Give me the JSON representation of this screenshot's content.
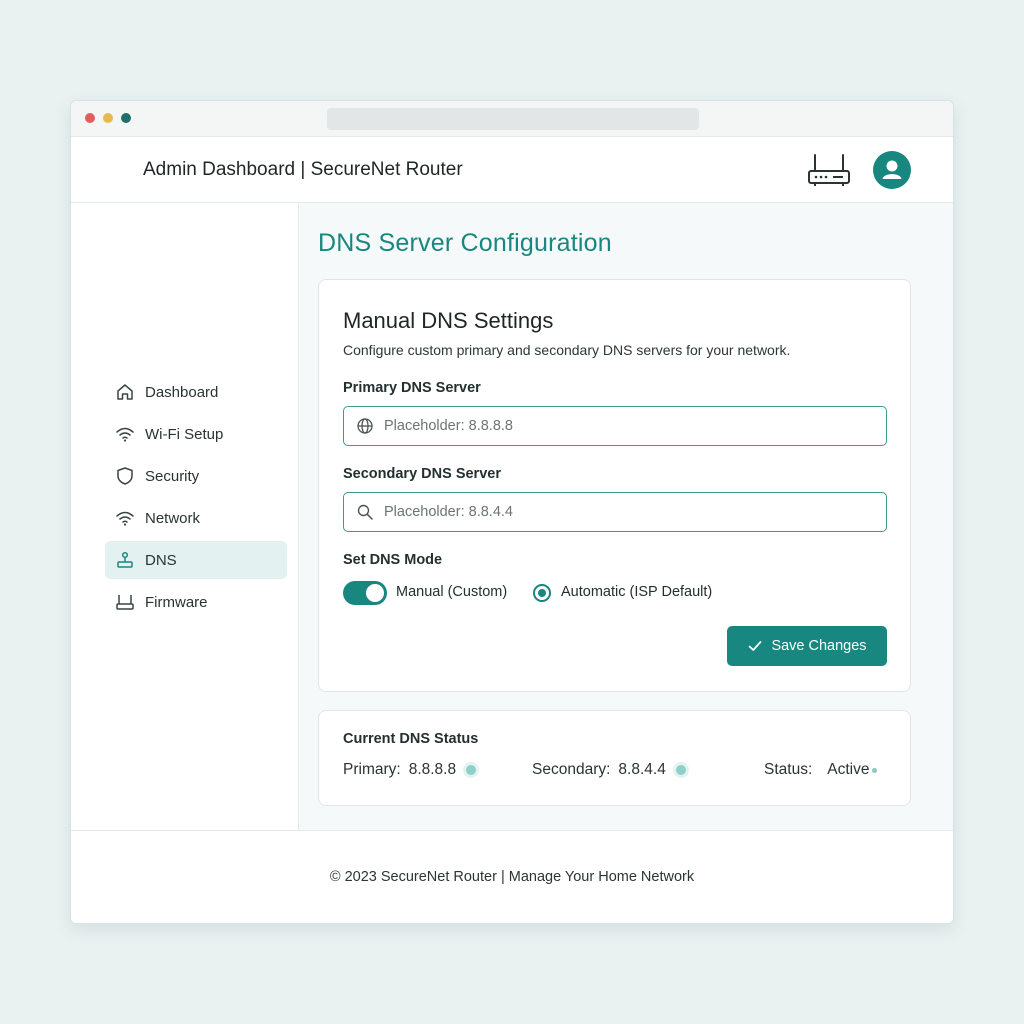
{
  "header": {
    "title": "Admin Dashboard | SecureNet Router"
  },
  "sidebar": {
    "items": [
      {
        "label": "Dashboard",
        "icon": "home-icon"
      },
      {
        "label": "Wi-Fi Setup",
        "icon": "wifi-icon"
      },
      {
        "label": "Security",
        "icon": "shield-icon"
      },
      {
        "label": "Network",
        "icon": "wifi-icon"
      },
      {
        "label": "DNS",
        "icon": "dns-icon",
        "active": true
      },
      {
        "label": "Firmware",
        "icon": "router-icon"
      }
    ]
  },
  "main": {
    "page_title": "DNS Server Configuration",
    "settings": {
      "title": "Manual DNS Settings",
      "description": "Configure custom primary and secondary DNS servers for your network.",
      "primary_label": "Primary DNS Server",
      "primary_placeholder": "Placeholder: 8.8.8.8",
      "secondary_label": "Secondary DNS Server",
      "secondary_placeholder": "Placeholder: 8.8.4.4",
      "mode_label": "Set DNS Mode",
      "manual_label": "Manual (Custom)",
      "manual_enabled": true,
      "automatic_label": "Automatic (ISP Default)",
      "automatic_selected": true,
      "save_label": "Save Changes"
    },
    "status": {
      "title": "Current DNS Status",
      "primary_label": "Primary:",
      "primary_value": "8.8.8.8",
      "secondary_label": "Secondary:",
      "secondary_value": "8.8.4.4",
      "status_label": "Status:",
      "status_value": "Active"
    }
  },
  "footer": {
    "text": "© 2023 SecureNet Router | Manage Your Home Network"
  },
  "colors": {
    "accent": "#17877f",
    "active_nav_bg": "#e3f2f0",
    "status_dot": "#8fd0c8"
  }
}
